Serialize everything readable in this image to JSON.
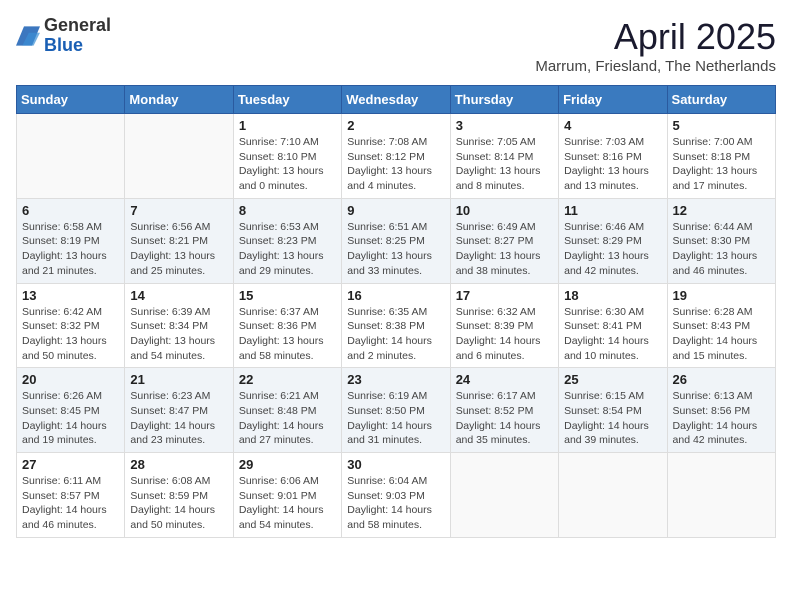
{
  "logo": {
    "general": "General",
    "blue": "Blue"
  },
  "title": "April 2025",
  "location": "Marrum, Friesland, The Netherlands",
  "weekdays": [
    "Sunday",
    "Monday",
    "Tuesday",
    "Wednesday",
    "Thursday",
    "Friday",
    "Saturday"
  ],
  "weeks": [
    [
      {
        "day": "",
        "sunrise": "",
        "sunset": "",
        "daylight": ""
      },
      {
        "day": "",
        "sunrise": "",
        "sunset": "",
        "daylight": ""
      },
      {
        "day": "1",
        "sunrise": "Sunrise: 7:10 AM",
        "sunset": "Sunset: 8:10 PM",
        "daylight": "Daylight: 13 hours and 0 minutes."
      },
      {
        "day": "2",
        "sunrise": "Sunrise: 7:08 AM",
        "sunset": "Sunset: 8:12 PM",
        "daylight": "Daylight: 13 hours and 4 minutes."
      },
      {
        "day": "3",
        "sunrise": "Sunrise: 7:05 AM",
        "sunset": "Sunset: 8:14 PM",
        "daylight": "Daylight: 13 hours and 8 minutes."
      },
      {
        "day": "4",
        "sunrise": "Sunrise: 7:03 AM",
        "sunset": "Sunset: 8:16 PM",
        "daylight": "Daylight: 13 hours and 13 minutes."
      },
      {
        "day": "5",
        "sunrise": "Sunrise: 7:00 AM",
        "sunset": "Sunset: 8:18 PM",
        "daylight": "Daylight: 13 hours and 17 minutes."
      }
    ],
    [
      {
        "day": "6",
        "sunrise": "Sunrise: 6:58 AM",
        "sunset": "Sunset: 8:19 PM",
        "daylight": "Daylight: 13 hours and 21 minutes."
      },
      {
        "day": "7",
        "sunrise": "Sunrise: 6:56 AM",
        "sunset": "Sunset: 8:21 PM",
        "daylight": "Daylight: 13 hours and 25 minutes."
      },
      {
        "day": "8",
        "sunrise": "Sunrise: 6:53 AM",
        "sunset": "Sunset: 8:23 PM",
        "daylight": "Daylight: 13 hours and 29 minutes."
      },
      {
        "day": "9",
        "sunrise": "Sunrise: 6:51 AM",
        "sunset": "Sunset: 8:25 PM",
        "daylight": "Daylight: 13 hours and 33 minutes."
      },
      {
        "day": "10",
        "sunrise": "Sunrise: 6:49 AM",
        "sunset": "Sunset: 8:27 PM",
        "daylight": "Daylight: 13 hours and 38 minutes."
      },
      {
        "day": "11",
        "sunrise": "Sunrise: 6:46 AM",
        "sunset": "Sunset: 8:29 PM",
        "daylight": "Daylight: 13 hours and 42 minutes."
      },
      {
        "day": "12",
        "sunrise": "Sunrise: 6:44 AM",
        "sunset": "Sunset: 8:30 PM",
        "daylight": "Daylight: 13 hours and 46 minutes."
      }
    ],
    [
      {
        "day": "13",
        "sunrise": "Sunrise: 6:42 AM",
        "sunset": "Sunset: 8:32 PM",
        "daylight": "Daylight: 13 hours and 50 minutes."
      },
      {
        "day": "14",
        "sunrise": "Sunrise: 6:39 AM",
        "sunset": "Sunset: 8:34 PM",
        "daylight": "Daylight: 13 hours and 54 minutes."
      },
      {
        "day": "15",
        "sunrise": "Sunrise: 6:37 AM",
        "sunset": "Sunset: 8:36 PM",
        "daylight": "Daylight: 13 hours and 58 minutes."
      },
      {
        "day": "16",
        "sunrise": "Sunrise: 6:35 AM",
        "sunset": "Sunset: 8:38 PM",
        "daylight": "Daylight: 14 hours and 2 minutes."
      },
      {
        "day": "17",
        "sunrise": "Sunrise: 6:32 AM",
        "sunset": "Sunset: 8:39 PM",
        "daylight": "Daylight: 14 hours and 6 minutes."
      },
      {
        "day": "18",
        "sunrise": "Sunrise: 6:30 AM",
        "sunset": "Sunset: 8:41 PM",
        "daylight": "Daylight: 14 hours and 10 minutes."
      },
      {
        "day": "19",
        "sunrise": "Sunrise: 6:28 AM",
        "sunset": "Sunset: 8:43 PM",
        "daylight": "Daylight: 14 hours and 15 minutes."
      }
    ],
    [
      {
        "day": "20",
        "sunrise": "Sunrise: 6:26 AM",
        "sunset": "Sunset: 8:45 PM",
        "daylight": "Daylight: 14 hours and 19 minutes."
      },
      {
        "day": "21",
        "sunrise": "Sunrise: 6:23 AM",
        "sunset": "Sunset: 8:47 PM",
        "daylight": "Daylight: 14 hours and 23 minutes."
      },
      {
        "day": "22",
        "sunrise": "Sunrise: 6:21 AM",
        "sunset": "Sunset: 8:48 PM",
        "daylight": "Daylight: 14 hours and 27 minutes."
      },
      {
        "day": "23",
        "sunrise": "Sunrise: 6:19 AM",
        "sunset": "Sunset: 8:50 PM",
        "daylight": "Daylight: 14 hours and 31 minutes."
      },
      {
        "day": "24",
        "sunrise": "Sunrise: 6:17 AM",
        "sunset": "Sunset: 8:52 PM",
        "daylight": "Daylight: 14 hours and 35 minutes."
      },
      {
        "day": "25",
        "sunrise": "Sunrise: 6:15 AM",
        "sunset": "Sunset: 8:54 PM",
        "daylight": "Daylight: 14 hours and 39 minutes."
      },
      {
        "day": "26",
        "sunrise": "Sunrise: 6:13 AM",
        "sunset": "Sunset: 8:56 PM",
        "daylight": "Daylight: 14 hours and 42 minutes."
      }
    ],
    [
      {
        "day": "27",
        "sunrise": "Sunrise: 6:11 AM",
        "sunset": "Sunset: 8:57 PM",
        "daylight": "Daylight: 14 hours and 46 minutes."
      },
      {
        "day": "28",
        "sunrise": "Sunrise: 6:08 AM",
        "sunset": "Sunset: 8:59 PM",
        "daylight": "Daylight: 14 hours and 50 minutes."
      },
      {
        "day": "29",
        "sunrise": "Sunrise: 6:06 AM",
        "sunset": "Sunset: 9:01 PM",
        "daylight": "Daylight: 14 hours and 54 minutes."
      },
      {
        "day": "30",
        "sunrise": "Sunrise: 6:04 AM",
        "sunset": "Sunset: 9:03 PM",
        "daylight": "Daylight: 14 hours and 58 minutes."
      },
      {
        "day": "",
        "sunrise": "",
        "sunset": "",
        "daylight": ""
      },
      {
        "day": "",
        "sunrise": "",
        "sunset": "",
        "daylight": ""
      },
      {
        "day": "",
        "sunrise": "",
        "sunset": "",
        "daylight": ""
      }
    ]
  ]
}
